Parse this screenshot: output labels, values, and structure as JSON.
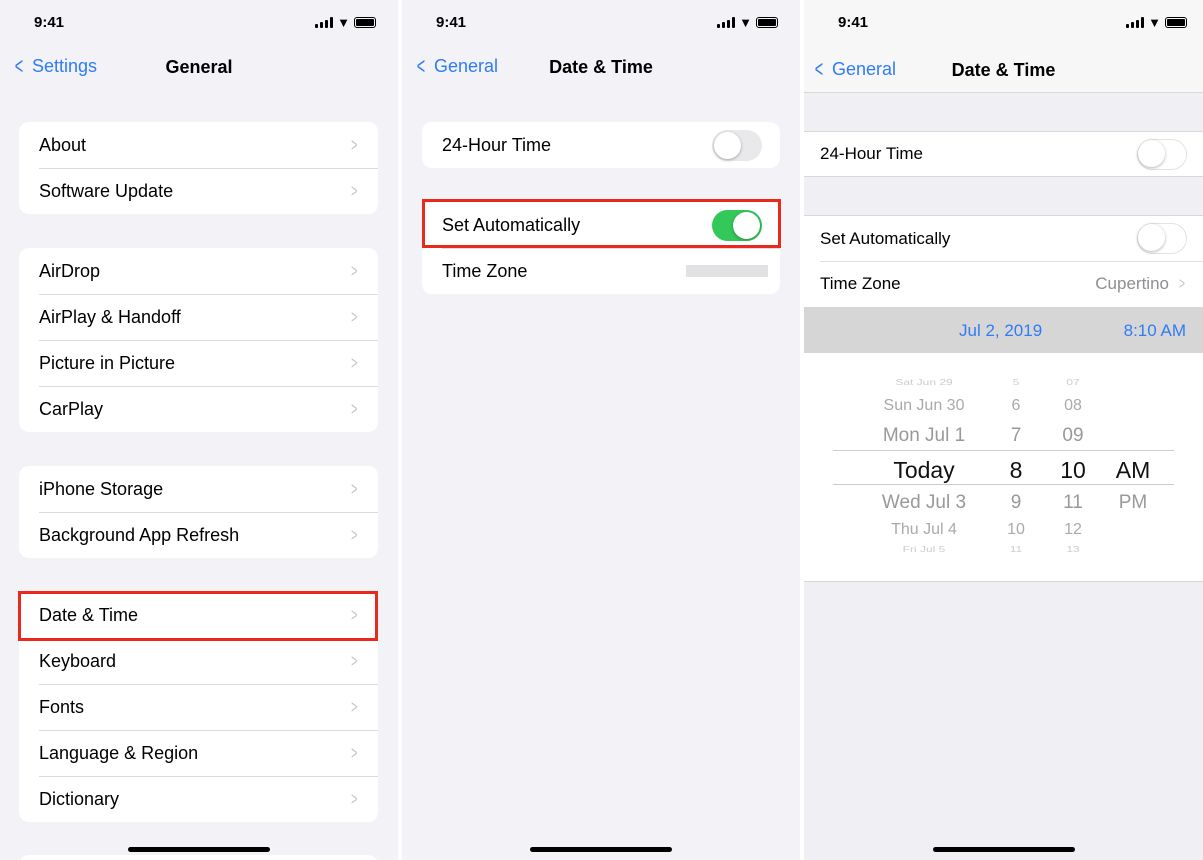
{
  "status_time": "9:41",
  "panel1": {
    "back_label": "Settings",
    "title": "General",
    "groups": [
      [
        "About",
        "Software Update"
      ],
      [
        "AirDrop",
        "AirPlay & Handoff",
        "Picture in Picture",
        "CarPlay"
      ],
      [
        "iPhone Storage",
        "Background App Refresh"
      ],
      [
        "Date & Time",
        "Keyboard",
        "Fonts",
        "Language & Region",
        "Dictionary"
      ]
    ],
    "highlighted": "Date & Time"
  },
  "panel2": {
    "back_label": "General",
    "title": "Date & Time",
    "hour24_label": "24-Hour Time",
    "hour24_on": false,
    "set_auto_label": "Set Automatically",
    "set_auto_on": true,
    "timezone_label": "Time Zone"
  },
  "panel3": {
    "back_label": "General",
    "title": "Date & Time",
    "hour24_label": "24-Hour Time",
    "hour24_on": false,
    "set_auto_label": "Set Automatically",
    "set_auto_on": false,
    "timezone_label": "Time Zone",
    "timezone_value": "Cupertino",
    "date_value": "Jul 2, 2019",
    "time_value": "8:10 AM",
    "picker": {
      "days": [
        "Sat Jun 29",
        "Sun Jun 30",
        "Mon Jul 1",
        "Today",
        "Wed Jul 3",
        "Thu Jul 4",
        "Fri Jul 5"
      ],
      "hours": [
        "5",
        "6",
        "7",
        "8",
        "9",
        "10",
        "11"
      ],
      "minutes": [
        "07",
        "08",
        "09",
        "10",
        "11",
        "12",
        "13"
      ],
      "ampm": [
        "AM",
        "PM"
      ]
    }
  },
  "colors": {
    "accent": "#2f7cf6",
    "toggle_on": "#34c759",
    "highlight_box": "#e8291c"
  }
}
